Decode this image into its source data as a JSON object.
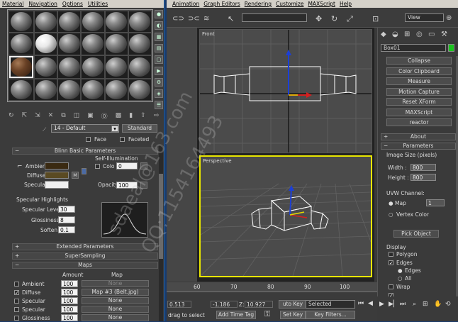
{
  "left_menu": {
    "items": [
      "Material",
      "Navigation",
      "Options",
      "Utilities"
    ]
  },
  "main_menu": {
    "items": [
      "Animation",
      "Graph Editors",
      "Rendering",
      "Customize",
      "MAXScript",
      "Help"
    ]
  },
  "toolbar": {
    "view_select": "View"
  },
  "material": {
    "name": "14 - Default",
    "type_button": "Standard",
    "face_label": "Face",
    "faceted_label": "Faceted",
    "blinn_header": "Blinn Basic Parameters",
    "self_illum_group": "Self-Illumination",
    "ambient_label": "Ambient:",
    "diffuse_label": "Diffuse:",
    "specular_label": "Specular:",
    "m_label": "M",
    "color_label": "Colo",
    "self_illum_value": "0",
    "opacity_label": "Opacity:",
    "opacity_value": "100",
    "spec_group": "Specular Highlights",
    "spec_level_label": "Specular Level:",
    "spec_level_value": "30",
    "gloss_label": "Glossiness:",
    "gloss_value": "8",
    "soften_label": "Soften:",
    "soften_value": "0.1",
    "extended_header": "Extended Parameters",
    "supersampling_header": "SuperSampling",
    "maps_header": "Maps",
    "amount_col": "Amount",
    "map_col": "Map",
    "maps": [
      {
        "name": "Ambient",
        "checked": false,
        "amount": "100",
        "map": "None"
      },
      {
        "name": "Diffuse",
        "checked": true,
        "amount": "100",
        "map": "Map #3 (Belt.jpg)"
      },
      {
        "name": "Specular",
        "checked": false,
        "amount": "100",
        "map": "None"
      },
      {
        "name": "Specular",
        "checked": false,
        "amount": "100",
        "map": "None"
      },
      {
        "name": "Glossiness",
        "checked": false,
        "amount": "100",
        "map": "None"
      }
    ],
    "colors": {
      "ambient": "#3a2a12",
      "diffuse": "#5a4a22",
      "specular": "#f0f0f0"
    }
  },
  "viewports": {
    "front_label": "Front",
    "persp_label": "Perspective"
  },
  "command_panel": {
    "object_name": "Box01",
    "buttons": [
      "Collapse",
      "Color Clipboard",
      "Measure",
      "Motion Capture",
      "Reset XForm",
      "MAXScript",
      "reactor"
    ],
    "about_header": "About",
    "params_header": "Parameters",
    "image_size_label": "Image Size (pixels)",
    "width_label": "Width :",
    "width_value": "800",
    "height_label": "Height :",
    "height_value": "800",
    "uvw_label": "UVW Channel:",
    "map_label": "Map",
    "map_value": "1",
    "vertex_color_label": "Vertex Color",
    "pick_object": "Pick Object",
    "display_label": "Display",
    "polygon_label": "Polygon",
    "edges_label": "Edges",
    "edges_sub": "Edges",
    "all_label": "All",
    "wrap_label": "Wrap"
  },
  "status": {
    "ticks": [
      "60",
      "70",
      "80",
      "90",
      "100"
    ],
    "coord_x": "0.513",
    "coord_y": "-1.186",
    "z_label": "Z:",
    "coord_z": "10.927",
    "auto_key": "uto Key",
    "selected": "Selected",
    "prompt": "drag to select",
    "add_time_tag": "Add Time Tag",
    "set_key": "Set Key",
    "key_filters": "Key Filters..."
  },
  "watermarks": [
    "sdaeal@163.com",
    "QQ:1154164493"
  ]
}
